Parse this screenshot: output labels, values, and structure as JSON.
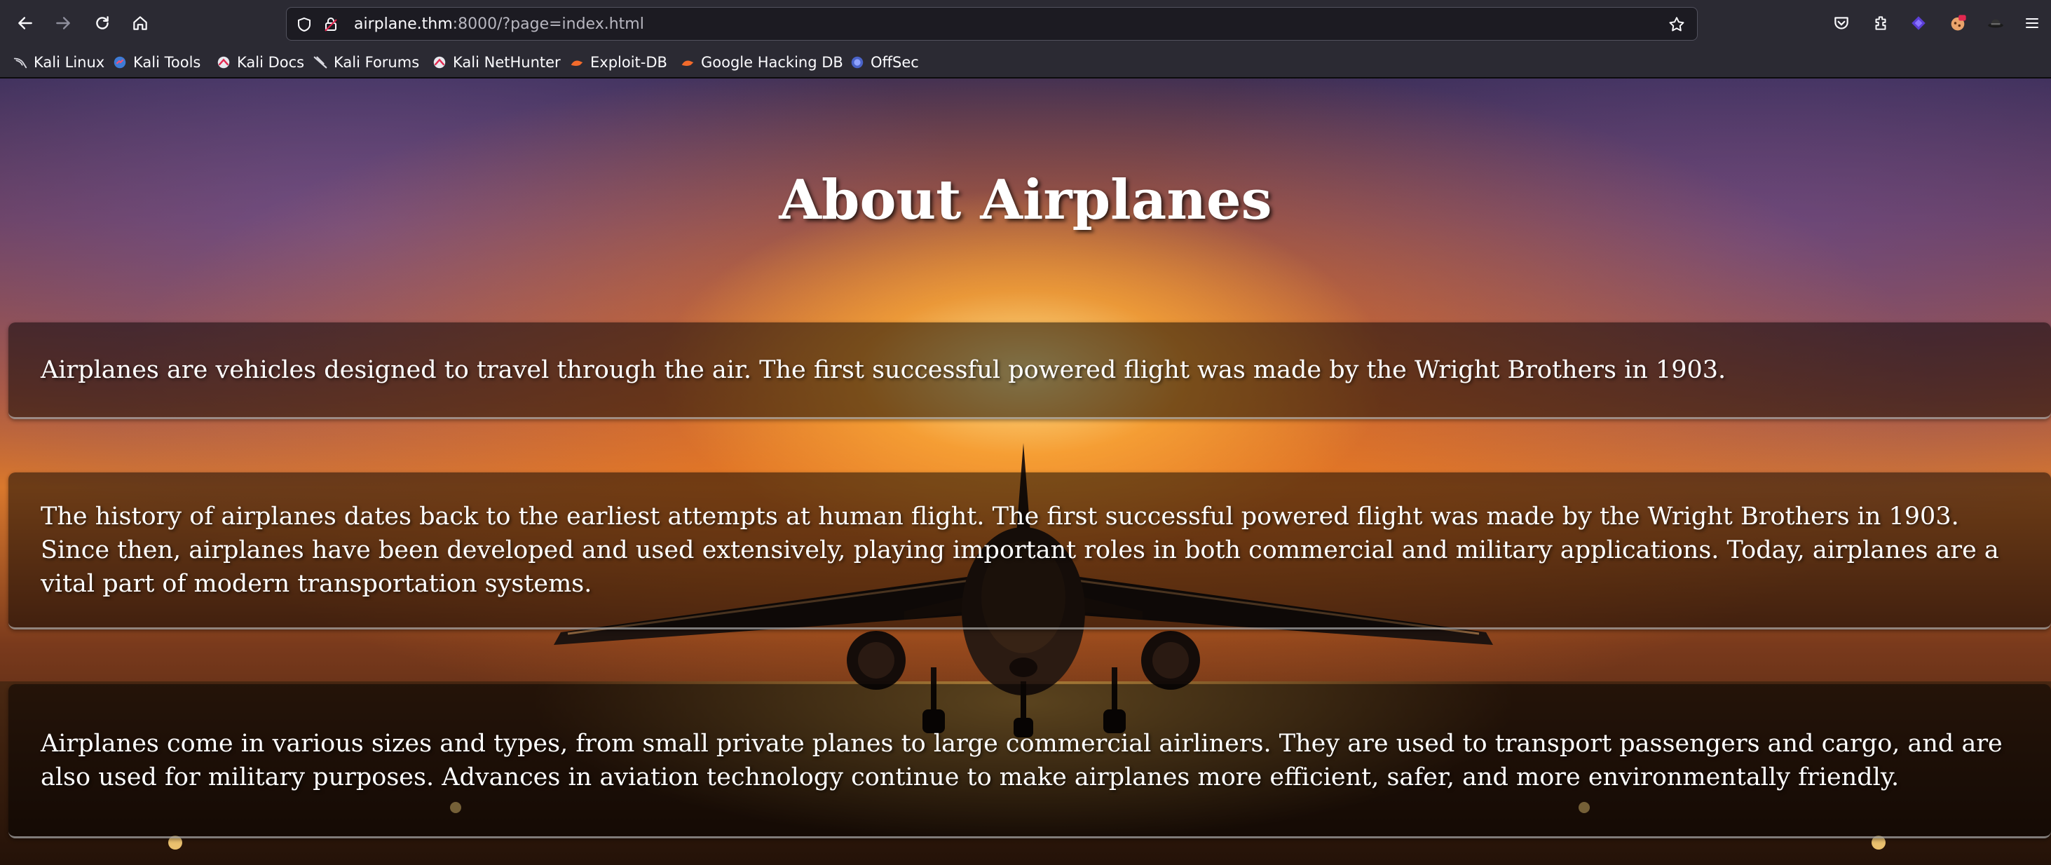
{
  "browser": {
    "url_host": "airplane.thm",
    "url_rest": ":8000/?page=index.html",
    "bookmarks": [
      {
        "label": "Kali Linux",
        "icon": "kali-dragon-icon"
      },
      {
        "label": "Kali Tools",
        "icon": "kali-tools-icon"
      },
      {
        "label": "Kali Docs",
        "icon": "kali-docs-icon"
      },
      {
        "label": "Kali Forums",
        "icon": "kali-forums-icon"
      },
      {
        "label": "Kali NetHunter",
        "icon": "kali-nethunter-icon"
      },
      {
        "label": "Exploit-DB",
        "icon": "exploit-db-icon"
      },
      {
        "label": "Google Hacking DB",
        "icon": "ghdb-icon"
      },
      {
        "label": "OffSec",
        "icon": "offsec-icon"
      }
    ]
  },
  "page": {
    "title": "About Airplanes",
    "paragraphs": [
      "Airplanes are vehicles designed to travel through the air. The first successful powered flight was made by the Wright Brothers in 1903.",
      "The history of airplanes dates back to the earliest attempts at human flight. The first successful powered flight was made by the Wright Brothers in 1903. Since then, airplanes have been developed and used extensively, playing important roles in both commercial and military applications. Today, airplanes are a vital part of modern transportation systems.",
      "Airplanes come in various sizes and types, from small private planes to large commercial airliners. They are used to transport passengers and cargo, and are also used for military purposes. Advances in aviation technology continue to make airplanes more efficient, safer, and more environmentally friendly."
    ]
  }
}
